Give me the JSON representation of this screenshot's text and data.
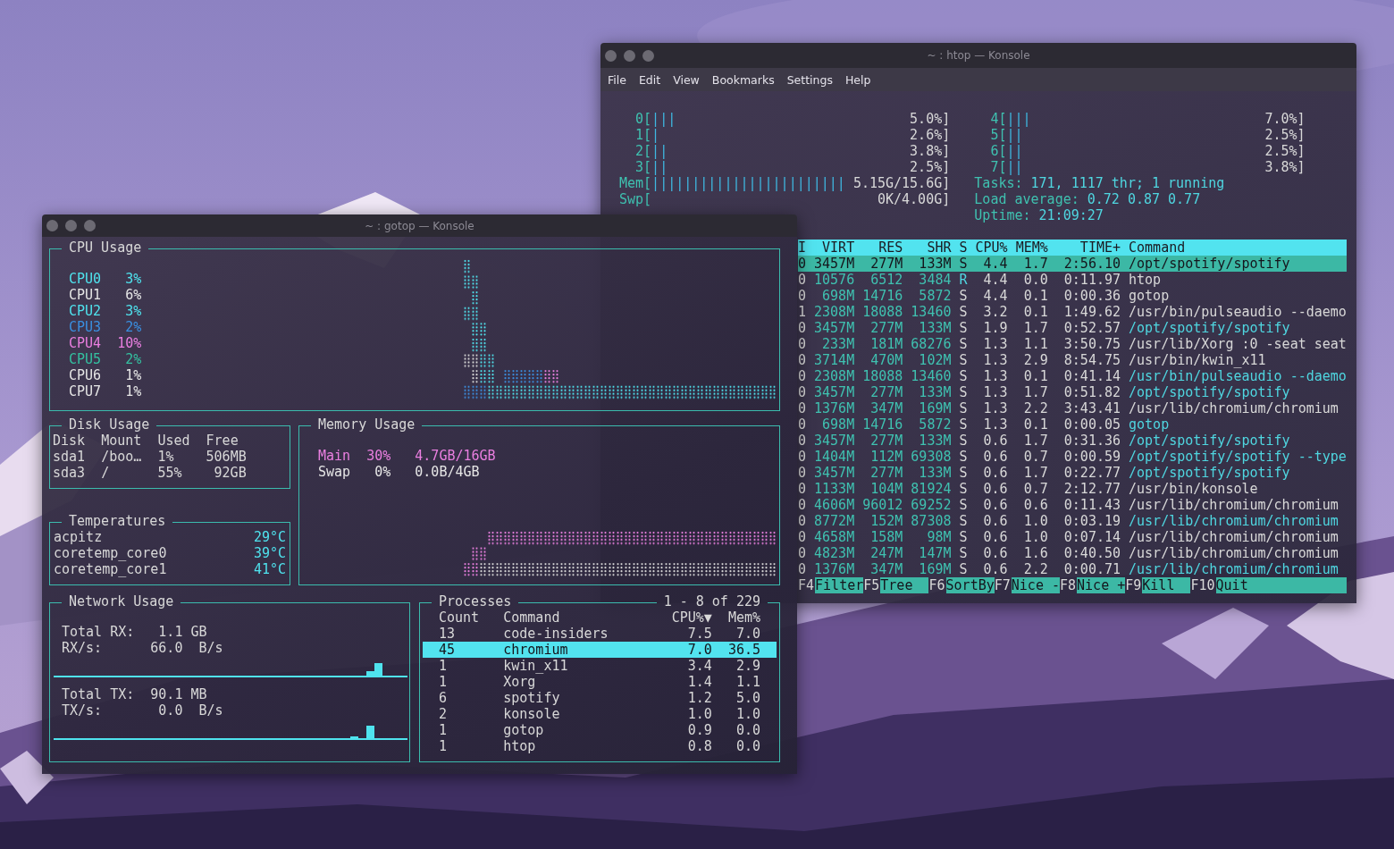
{
  "htop_window": {
    "title": "~ : htop — Konsole",
    "menu": [
      "File",
      "Edit",
      "View",
      "Bookmarks",
      "Settings",
      "Help"
    ],
    "meters_left": [
      {
        "kind": "cpu",
        "label": "0[",
        "bars": "|||",
        "reading": "5.0%]"
      },
      {
        "kind": "cpu",
        "label": "1[",
        "bars": "|",
        "reading": "2.6%]"
      },
      {
        "kind": "cpu",
        "label": "2[",
        "bars": "||",
        "reading": "3.8%]"
      },
      {
        "kind": "cpu",
        "label": "3[",
        "bars": "||",
        "reading": "2.5%]"
      },
      {
        "kind": "cpu",
        "label": "Mem[",
        "bars": "||||||||||||||||||||||||",
        "reading": "5.15G/15.6G]"
      },
      {
        "kind": "cpu",
        "label": "Swp[",
        "reading": "0K/4.00G]"
      }
    ],
    "meters_right": [
      {
        "kind": "cpu",
        "label": "4[",
        "bars": "|||",
        "reading": "7.0%]"
      },
      {
        "kind": "cpu",
        "label": "5[",
        "bars": "||",
        "reading": "2.5%]"
      },
      {
        "kind": "cpu",
        "label": "6[",
        "bars": "||",
        "reading": "2.5%]"
      },
      {
        "kind": "cpu",
        "label": "7[",
        "bars": "||",
        "reading": "3.8%]"
      },
      {
        "kind": "info",
        "label": "Tasks:",
        "value": "171, 1117 thr; 1 running"
      },
      {
        "kind": "info",
        "label": "Load average:",
        "value": "0.72 0.87 0.77"
      },
      {
        "kind": "info",
        "label": "Uptime:",
        "value": "21:09:27"
      }
    ],
    "columns": [
      "I",
      "VIRT",
      "RES",
      "SHR",
      "S",
      "CPU%",
      "MEM%",
      "TIME+",
      "Command"
    ],
    "processes": [
      {
        "cells": [
          "0",
          "3457M",
          "277M",
          "133M",
          "S",
          "4.4",
          "1.7",
          "2:56.10",
          "/opt/spotify/spotify"
        ],
        "selected": true,
        "thread": false,
        "running": false
      },
      {
        "cells": [
          "0",
          "10576",
          "6512",
          "3484",
          "R",
          "4.4",
          "0.0",
          "0:11.97",
          "htop"
        ],
        "selected": false,
        "thread": false,
        "running": true
      },
      {
        "cells": [
          "0",
          "698M",
          "14716",
          "5872",
          "S",
          "4.4",
          "0.1",
          "0:00.36",
          "gotop"
        ],
        "selected": false,
        "thread": false,
        "running": false
      },
      {
        "cells": [
          "1",
          "2308M",
          "18088",
          "13460",
          "S",
          "3.2",
          "0.1",
          "1:49.62",
          "/usr/bin/pulseaudio --daemo"
        ],
        "selected": false,
        "thread": false,
        "running": false
      },
      {
        "cells": [
          "0",
          "3457M",
          "277M",
          "133M",
          "S",
          "1.9",
          "1.7",
          "0:52.57",
          "/opt/spotify/spotify"
        ],
        "selected": false,
        "thread": true,
        "running": false
      },
      {
        "cells": [
          "0",
          "233M",
          "181M",
          "68276",
          "S",
          "1.3",
          "1.1",
          "3:50.75",
          "/usr/lib/Xorg :0 -seat seat"
        ],
        "selected": false,
        "thread": false,
        "running": false
      },
      {
        "cells": [
          "0",
          "3714M",
          "470M",
          "102M",
          "S",
          "1.3",
          "2.9",
          "8:54.75",
          "/usr/bin/kwin_x11"
        ],
        "selected": false,
        "thread": false,
        "running": false
      },
      {
        "cells": [
          "0",
          "2308M",
          "18088",
          "13460",
          "S",
          "1.3",
          "0.1",
          "0:41.14",
          "/usr/bin/pulseaudio --daemo"
        ],
        "selected": false,
        "thread": true,
        "running": false
      },
      {
        "cells": [
          "0",
          "3457M",
          "277M",
          "133M",
          "S",
          "1.3",
          "1.7",
          "0:51.82",
          "/opt/spotify/spotify"
        ],
        "selected": false,
        "thread": true,
        "running": false
      },
      {
        "cells": [
          "0",
          "1376M",
          "347M",
          "169M",
          "S",
          "1.3",
          "2.2",
          "3:43.41",
          "/usr/lib/chromium/chromium"
        ],
        "selected": false,
        "thread": false,
        "running": false
      },
      {
        "cells": [
          "0",
          "698M",
          "14716",
          "5872",
          "S",
          "1.3",
          "0.1",
          "0:00.05",
          "gotop"
        ],
        "selected": false,
        "thread": true,
        "running": false
      },
      {
        "cells": [
          "0",
          "3457M",
          "277M",
          "133M",
          "S",
          "0.6",
          "1.7",
          "0:31.36",
          "/opt/spotify/spotify"
        ],
        "selected": false,
        "thread": true,
        "running": false
      },
      {
        "cells": [
          "0",
          "1404M",
          "112M",
          "69308",
          "S",
          "0.6",
          "0.7",
          "0:00.59",
          "/opt/spotify/spotify --type"
        ],
        "selected": false,
        "thread": true,
        "running": false
      },
      {
        "cells": [
          "0",
          "3457M",
          "277M",
          "133M",
          "S",
          "0.6",
          "1.7",
          "0:22.77",
          "/opt/spotify/spotify"
        ],
        "selected": false,
        "thread": true,
        "running": false
      },
      {
        "cells": [
          "0",
          "1133M",
          "104M",
          "81924",
          "S",
          "0.6",
          "0.7",
          "2:12.77",
          "/usr/bin/konsole"
        ],
        "selected": false,
        "thread": false,
        "running": false
      },
      {
        "cells": [
          "0",
          "4606M",
          "96012",
          "69252",
          "S",
          "0.6",
          "0.6",
          "0:11.43",
          "/usr/lib/chromium/chromium"
        ],
        "selected": false,
        "thread": false,
        "running": false
      },
      {
        "cells": [
          "0",
          "8772M",
          "152M",
          "87308",
          "S",
          "0.6",
          "1.0",
          "0:03.19",
          "/usr/lib/chromium/chromium"
        ],
        "selected": false,
        "thread": true,
        "running": false
      },
      {
        "cells": [
          "0",
          "4658M",
          "158M",
          "98M",
          "S",
          "0.6",
          "1.0",
          "0:07.14",
          "/usr/lib/chromium/chromium"
        ],
        "selected": false,
        "thread": false,
        "running": false
      },
      {
        "cells": [
          "0",
          "4823M",
          "247M",
          "147M",
          "S",
          "0.6",
          "1.6",
          "0:40.50",
          "/usr/lib/chromium/chromium"
        ],
        "selected": false,
        "thread": false,
        "running": false
      },
      {
        "cells": [
          "0",
          "1376M",
          "347M",
          "169M",
          "S",
          "0.6",
          "2.2",
          "0:00.71",
          "/usr/lib/chromium/chromium"
        ],
        "selected": false,
        "thread": true,
        "running": false
      }
    ],
    "function_keys": [
      {
        "key": "F4",
        "label": "Filter"
      },
      {
        "key": "F5",
        "label": "Tree"
      },
      {
        "key": "F6",
        "label": "SortBy"
      },
      {
        "key": "F7",
        "label": "Nice -"
      },
      {
        "key": "F8",
        "label": "Nice +"
      },
      {
        "key": "F9",
        "label": "Kill"
      },
      {
        "key": "F10",
        "label": "Quit"
      }
    ]
  },
  "gotop_window": {
    "title": "~ : gotop — Konsole",
    "cpu": {
      "title": "CPU Usage",
      "cores": [
        {
          "name": "CPU0",
          "usage": "3%",
          "color": "#4fe3ee"
        },
        {
          "name": "CPU1",
          "usage": "6%",
          "color": "#e6e6e6"
        },
        {
          "name": "CPU2",
          "usage": "3%",
          "color": "#4fe3ee"
        },
        {
          "name": "CPU3",
          "usage": "2%",
          "color": "#3a8fe0"
        },
        {
          "name": "CPU4",
          "usage": "10%",
          "color": "#ea7fe0"
        },
        {
          "name": "CPU5",
          "usage": "2%",
          "color": "#34c0a0"
        },
        {
          "name": "CPU6",
          "usage": "1%",
          "color": "#e6e6e6"
        },
        {
          "name": "CPU7",
          "usage": "1%",
          "color": "#e6e6e6"
        }
      ]
    },
    "disk": {
      "title": "Disk Usage",
      "columns": [
        "Disk",
        "Mount",
        "Used",
        "Free"
      ],
      "rows": [
        [
          "sda1",
          "/boo…",
          "1%",
          "506MB"
        ],
        [
          "sda3",
          "/",
          "55%",
          "92GB"
        ]
      ]
    },
    "temperatures": {
      "title": "Temperatures",
      "sensors": [
        {
          "name": "acpitz",
          "value": "29°C"
        },
        {
          "name": "coretemp_core0",
          "value": "39°C"
        },
        {
          "name": "coretemp_core1",
          "value": "41°C"
        }
      ]
    },
    "memory": {
      "title": "Memory Usage",
      "items": [
        {
          "name": "Main",
          "percent": "30%",
          "amount": "4.7GB/16GB",
          "color": "#ea7fe0"
        },
        {
          "name": "Swap",
          "percent": "0%",
          "amount": "0.0B/4GB",
          "color": "#e6e6e6"
        }
      ]
    },
    "network": {
      "title": "Network Usage",
      "sections": [
        {
          "rows": [
            {
              "kind": "total",
              "label": "Total RX:",
              "amount": "1.1",
              "unit": "GB"
            },
            {
              "kind": "rate",
              "label": "RX/s:",
              "amount": "66.0",
              "unit": "B/s"
            }
          ]
        },
        {
          "rows": [
            {
              "kind": "total",
              "label": "Total TX:",
              "amount": "90.1",
              "unit": "MB"
            },
            {
              "kind": "rate",
              "label": "TX/s:",
              "amount": "0.0",
              "unit": "B/s"
            }
          ]
        }
      ]
    },
    "processes": {
      "title": "Processes",
      "range": "1 - 8 of 229",
      "columns": [
        "Count",
        "Command",
        "CPU%▼",
        "Mem%"
      ],
      "rows": [
        {
          "cells": [
            "13",
            "code-insiders",
            "7.5",
            "7.0"
          ],
          "selected": false
        },
        {
          "cells": [
            "45",
            "chromium",
            "7.0",
            "36.5"
          ],
          "selected": true
        },
        {
          "cells": [
            "1",
            "kwin_x11",
            "3.4",
            "2.9"
          ],
          "selected": false
        },
        {
          "cells": [
            "1",
            "Xorg",
            "1.4",
            "1.1"
          ],
          "selected": false
        },
        {
          "cells": [
            "6",
            "spotify",
            "1.2",
            "5.0"
          ],
          "selected": false
        },
        {
          "cells": [
            "2",
            "konsole",
            "1.0",
            "1.0"
          ],
          "selected": false
        },
        {
          "cells": [
            "1",
            "gotop",
            "0.9",
            "0.0"
          ],
          "selected": false
        },
        {
          "cells": [
            "1",
            "htop",
            "0.8",
            "0.0"
          ],
          "selected": false
        }
      ]
    }
  }
}
